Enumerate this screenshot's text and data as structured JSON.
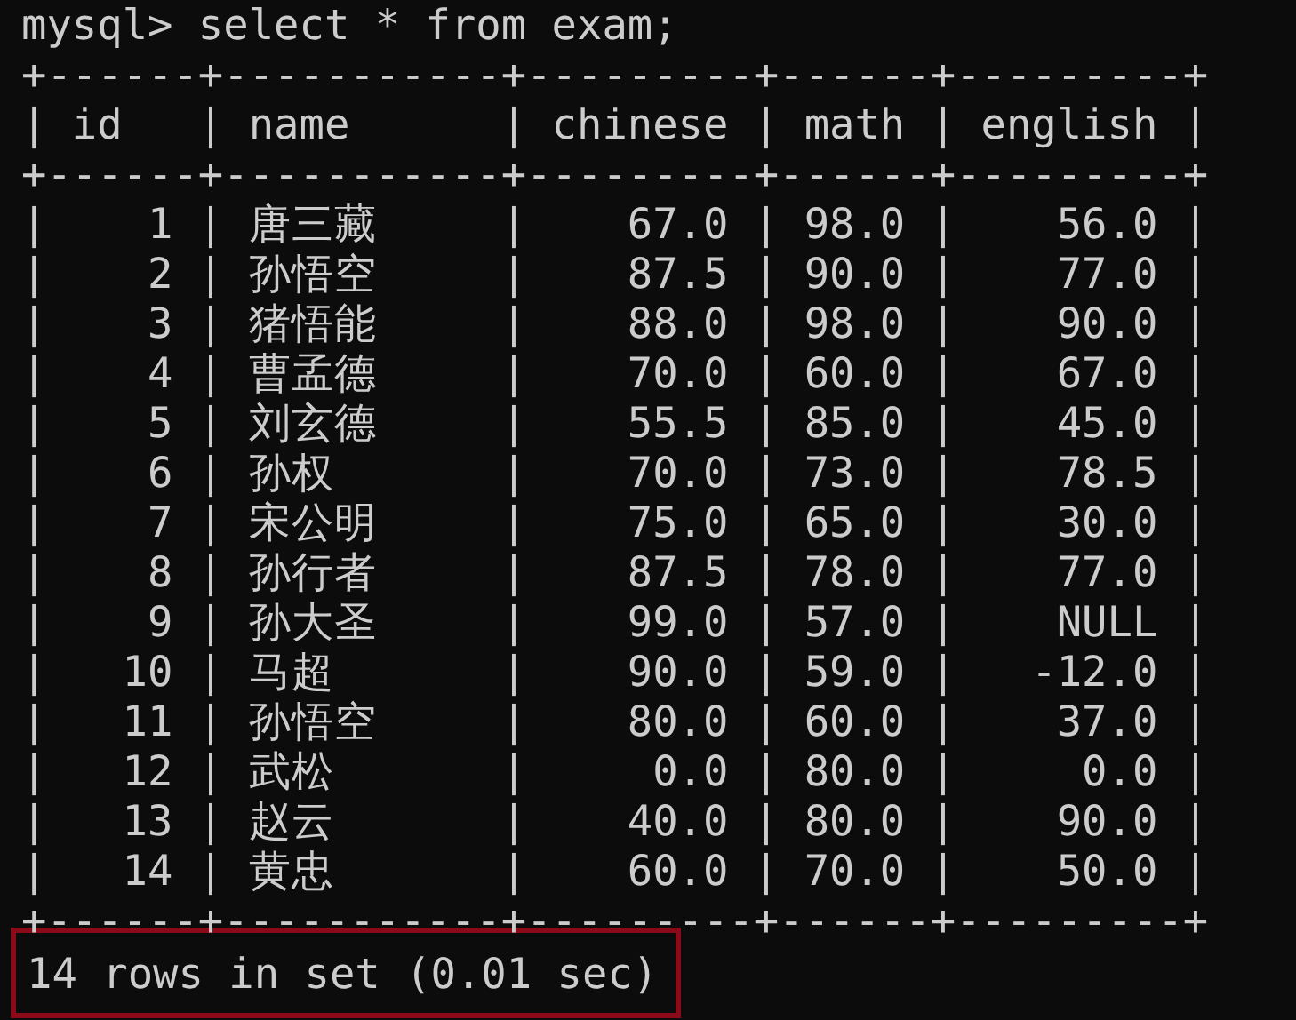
{
  "prompt": "mysql> select * from exam;",
  "table": {
    "borders": [
      "+------+-----------+---------+------+---------+",
      "+------+-----------+---------+------+---------+",
      "+------+-----------+---------+------+---------+"
    ],
    "separator": "|",
    "columns": [
      {
        "label": "id",
        "kind": "number"
      },
      {
        "label": "name",
        "kind": "text"
      },
      {
        "label": "chinese",
        "kind": "number"
      },
      {
        "label": "math",
        "kind": "number"
      },
      {
        "label": "english",
        "kind": "number"
      }
    ],
    "rows": [
      [
        "1",
        "唐三藏",
        "67.0",
        "98.0",
        "56.0"
      ],
      [
        "2",
        "孙悟空",
        "87.5",
        "90.0",
        "77.0"
      ],
      [
        "3",
        "猪悟能",
        "88.0",
        "98.0",
        "90.0"
      ],
      [
        "4",
        "曹孟德",
        "70.0",
        "60.0",
        "67.0"
      ],
      [
        "5",
        "刘玄德",
        "55.5",
        "85.0",
        "45.0"
      ],
      [
        "6",
        "孙权",
        "70.0",
        "73.0",
        "78.5"
      ],
      [
        "7",
        "宋公明",
        "75.0",
        "65.0",
        "30.0"
      ],
      [
        "8",
        "孙行者",
        "87.5",
        "78.0",
        "77.0"
      ],
      [
        "9",
        "孙大圣",
        "99.0",
        "57.0",
        "NULL"
      ],
      [
        "10",
        "马超",
        "90.0",
        "59.0",
        "-12.0"
      ],
      [
        "11",
        "孙悟空",
        "80.0",
        "60.0",
        "37.0"
      ],
      [
        "12",
        "武松",
        "0.0",
        "80.0",
        "0.0"
      ],
      [
        "13",
        "赵云",
        "40.0",
        "80.0",
        "90.0"
      ],
      [
        "14",
        "黄忠",
        "60.0",
        "70.0",
        "50.0"
      ]
    ]
  },
  "status": {
    "text": "14 rows in set (0.01 sec)",
    "highlighted": true
  }
}
